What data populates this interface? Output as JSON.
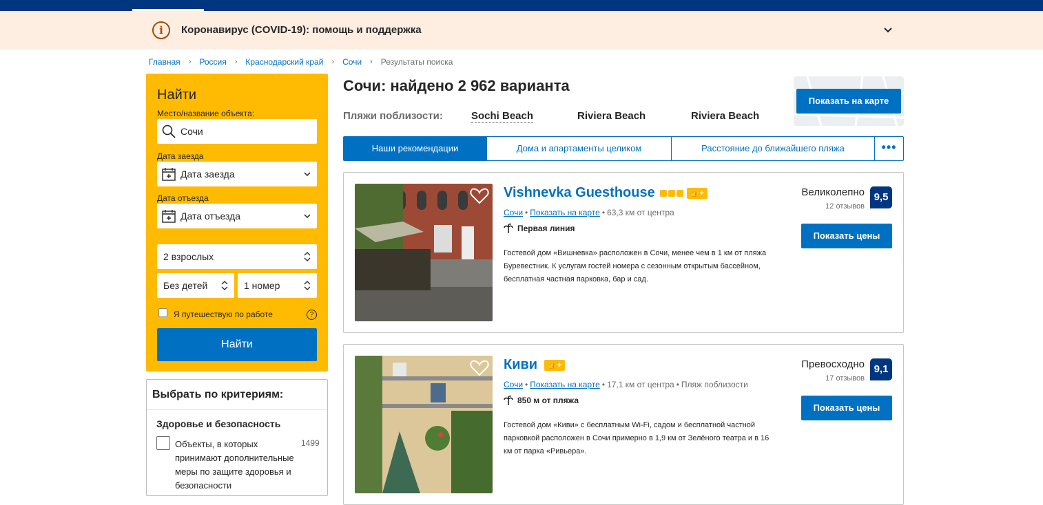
{
  "covid": {
    "text": "Коронавирус (COVID-19): помощь и поддержка",
    "icon": "info-icon"
  },
  "breadcrumb": [
    "Главная",
    "Россия",
    "Краснодарский край",
    "Сочи",
    "Результаты поиска"
  ],
  "search": {
    "title": "Найти",
    "destination_label": "Место/название объекта:",
    "destination_value": "Сочи",
    "checkin_label": "Дата заезда",
    "checkin_placeholder": "Дата заезда",
    "checkout_label": "Дата отъезда",
    "checkout_placeholder": "Дата отъезда",
    "adults": "2 взрослых",
    "children": "Без детей",
    "rooms": "1 номер",
    "work_travel": "Я путешествую по работе",
    "button": "Найти"
  },
  "filters": {
    "title": "Выбрать по критериям:",
    "section": "Здоровье и безопасность",
    "option": "Объекты, в которых принимают дополнительные меры по защите здоровья и безопасности",
    "option_count": "1499"
  },
  "results": {
    "heading": "Сочи: найдено 2 962 варианта",
    "beaches_label": "Пляжи поблизости:",
    "beaches": [
      "Sochi Beach",
      "Riviera Beach",
      "Riviera Beach"
    ],
    "map_button": "Показать на карте",
    "sort_tabs": [
      "Наши рекомендации",
      "Дома и апартаменты целиком",
      "Расстояние до ближайшего пляжа"
    ],
    "more": "•••"
  },
  "hotels": [
    {
      "name": "Vishnevka Guesthouse",
      "stars": 3,
      "city": "Сочи",
      "map_link": "Показать на карте",
      "distance": "63,3 км от центра",
      "extra": "",
      "tag": "Первая линия",
      "description": "Гостевой дом «Вишневка» расположен в Сочи, менее чем в 1 км от пляжа Буревестник. К услугам гостей номера с сезонным открытым бассейном, бесплатная частная парковка, бар и сад.",
      "rating_word": "Великолепно",
      "reviews": "12 отзывов",
      "score": "9,5",
      "button": "Показать цены"
    },
    {
      "name": "Киви",
      "stars": 0,
      "city": "Сочи",
      "map_link": "Показать на карте",
      "distance": "17,1 км от центра",
      "extra": "Пляж поблизости",
      "tag": "850 м от пляжа",
      "description": "Гостевой дом «Киви» с бесплатным Wi-Fi, садом и бесплатной частной парковкой расположен в Сочи примерно в 1,9 км от Зелёного театра и в 16 км от парка «Ривьера».",
      "rating_word": "Превосходно",
      "reviews": "17 отзывов",
      "score": "9,1",
      "button": "Показать цены"
    }
  ],
  "colors": {
    "brand": "#003580",
    "accent": "#0071c2",
    "search_bg": "#febb02",
    "banner_bg": "#fdeee1"
  }
}
